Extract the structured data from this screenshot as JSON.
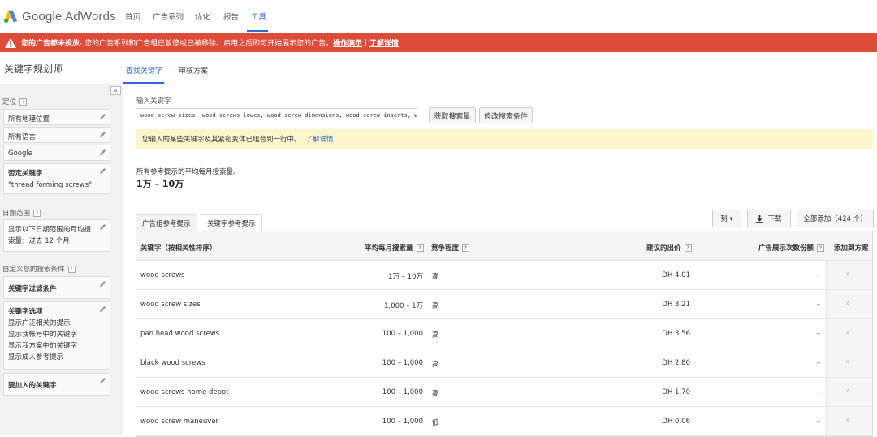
{
  "app": {
    "logo_text": "Google AdWords"
  },
  "topnav": [
    {
      "label": "首页",
      "active": false
    },
    {
      "label": "广告系列",
      "active": false
    },
    {
      "label": "优化",
      "active": false
    },
    {
      "label": "报告",
      "active": false
    },
    {
      "label": "工具",
      "active": true
    }
  ],
  "alert": {
    "bold": "您的广告都未投放",
    "text": " - 您的广告系列和广告组已暂停或已被移除。启用之后即可开始展示您的广告。",
    "link1": "操作演示",
    "sep": " | ",
    "link2": "了解详情",
    "color": "#dd4b39"
  },
  "page_title": "关键字规划师",
  "subtabs": [
    {
      "label": "查找关键字",
      "active": true
    },
    {
      "label": "审核方案",
      "active": false
    }
  ],
  "sidebar": {
    "collapse": "«",
    "targeting_label": "定位",
    "targeting": [
      "所有地理位置",
      "所有语言",
      "Google"
    ],
    "negative": {
      "title": "否定关键字",
      "value": "\"thread forming screws\""
    },
    "date_label": "日期范围",
    "date_value": "显示以下日期范围的月均搜索量：过去 12 个月",
    "custom_label": "自定义您的搜索条件",
    "filters_title": "关键字过滤条件",
    "options_title": "关键字选项",
    "options": [
      "显示广泛相关的提示",
      "显示我帐号中的关键字",
      "显示我方案中的关键字",
      "显示成人参考提示"
    ],
    "include_title": "要加入的关键字",
    "help": "?"
  },
  "search": {
    "label": "输入关键字",
    "value": "wood screw sizes, wood screws lowes, wood screw dimensions, wood screw inserts, woo",
    "get_volume": "获取搜索量",
    "modify": "修改搜索条件"
  },
  "notice": {
    "text": "您输入的某些关键字及其紧密变体已组合到一行中。",
    "link": "了解详情"
  },
  "avg": {
    "label": "所有参考提示的平均每月搜索量。",
    "value": "1万 – 10万"
  },
  "tabs": [
    {
      "label": "广告组参考提示",
      "active": false
    },
    {
      "label": "关键字参考提示",
      "active": true
    }
  ],
  "tools": {
    "columns": "列 ▾",
    "download": "下载",
    "add_all": "全部添加（424 个）"
  },
  "table": {
    "headers": [
      "关键字（按相关性排序）",
      "平均每月搜索量",
      "竞争程度",
      "建议的出价",
      "广告展示次数份额",
      "添加到方案"
    ],
    "rows": [
      {
        "keyword": "wood screws",
        "volume": "1万 – 10万",
        "competition": "高",
        "bid": "DH 4.01",
        "share": "–"
      },
      {
        "keyword": "wood screw sizes",
        "volume": "1,000 – 1万",
        "competition": "高",
        "bid": "DH 3.21",
        "share": "–"
      },
      {
        "keyword": "pan head wood screws",
        "volume": "100 – 1,000",
        "competition": "高",
        "bid": "DH 3.56",
        "share": "–"
      },
      {
        "keyword": "black wood screws",
        "volume": "100 – 1,000",
        "competition": "高",
        "bid": "DH 2.80",
        "share": "–"
      },
      {
        "keyword": "wood screws home depot",
        "volume": "100 – 1,000",
        "competition": "高",
        "bid": "DH 1.70",
        "share": "–"
      },
      {
        "keyword": "wood screw maneuver",
        "volume": "100 – 1,000",
        "competition": "低",
        "bid": "DH 0.06",
        "share": "–"
      }
    ],
    "add_icon": "»"
  }
}
